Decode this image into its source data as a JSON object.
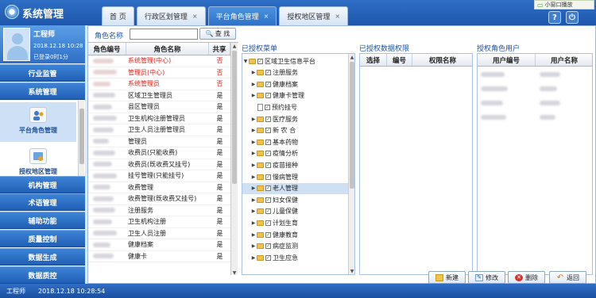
{
  "app": {
    "title": "系统管理"
  },
  "tabs": [
    {
      "label": "首 页",
      "closable": false
    },
    {
      "label": "行政区划管理",
      "closable": true
    },
    {
      "label": "平台角色管理",
      "closable": true,
      "active": true
    },
    {
      "label": "授权地区管理",
      "closable": true
    }
  ],
  "top": {
    "mini_player": "小窗口播放",
    "close_glyph": "×"
  },
  "user": {
    "name": "工程师",
    "date": "2018.12.18 10:28",
    "login_info": "已登录0时1分"
  },
  "sidebar": {
    "menus_top": [
      "行业监管",
      "系统管理"
    ],
    "sub_items": [
      "平台角色管理",
      "授权地区管理"
    ],
    "menus_bottom": [
      "机构管理",
      "术语管理",
      "辅助功能",
      "质量控制",
      "数据生成",
      "数据质控"
    ]
  },
  "filter": {
    "label": "角色名称",
    "value": "",
    "search_label": "查 找"
  },
  "role_grid": {
    "headers": [
      "角色编号",
      "角色名称",
      "共享"
    ],
    "rows": [
      {
        "name": "系统管理(中心)",
        "shared": "否",
        "highlight": true
      },
      {
        "name": "管理员(中心)",
        "shared": "否",
        "highlight": true
      },
      {
        "name": "系统管理员",
        "shared": "否",
        "highlight": true
      },
      {
        "name": "区域卫生管理员",
        "shared": "是"
      },
      {
        "name": "县区管理员",
        "shared": "是"
      },
      {
        "name": "卫生机构注册管理员",
        "shared": "是"
      },
      {
        "name": "卫生人员注册管理员",
        "shared": "是"
      },
      {
        "name": "管理员",
        "shared": "是"
      },
      {
        "name": "收费员(只能收费)",
        "shared": "是"
      },
      {
        "name": "收费员(既收费又挂号)",
        "shared": "是"
      },
      {
        "name": "挂号管理(只能挂号)",
        "shared": "是"
      },
      {
        "name": "收费管理",
        "shared": "是"
      },
      {
        "name": "收费管理(既收费又挂号)",
        "shared": "是"
      },
      {
        "name": "注册服务",
        "shared": "是"
      },
      {
        "name": "卫生机构注册",
        "shared": "是"
      },
      {
        "name": "卫生人员注册",
        "shared": "是"
      },
      {
        "name": "健康档案",
        "shared": "是"
      },
      {
        "name": "健康卡",
        "shared": "是"
      }
    ]
  },
  "menu_tree": {
    "title": "已授权菜单",
    "root": "区域卫生信息平台",
    "children": [
      {
        "label": "注册服务",
        "type": "folder"
      },
      {
        "label": "健康档案",
        "type": "folder"
      },
      {
        "label": "健康卡管理",
        "type": "folder"
      },
      {
        "label": "预约挂号",
        "type": "doc"
      },
      {
        "label": "医疗服务",
        "type": "folder"
      },
      {
        "label": "新 农 合",
        "type": "folder"
      },
      {
        "label": "基本药物",
        "type": "folder"
      },
      {
        "label": "疫情分析",
        "type": "folder"
      },
      {
        "label": "疫苗接种",
        "type": "folder"
      },
      {
        "label": "慢病管理",
        "type": "folder"
      },
      {
        "label": "老人管理",
        "type": "folder",
        "selected": true
      },
      {
        "label": "妇女保健",
        "type": "folder"
      },
      {
        "label": "儿童保健",
        "type": "folder"
      },
      {
        "label": "计划生育",
        "type": "folder"
      },
      {
        "label": "健康教育",
        "type": "folder"
      },
      {
        "label": "病症监测",
        "type": "folder"
      },
      {
        "label": "卫生应急",
        "type": "folder"
      }
    ]
  },
  "data_perm": {
    "title": "已授权数据权限",
    "headers": [
      "选择",
      "编号",
      "权限名称"
    ]
  },
  "perm_users": {
    "title": "授权角色用户",
    "headers": [
      "用户编号",
      "用户名称"
    ]
  },
  "actions": {
    "new_label": "新建",
    "edit_label": "修改",
    "delete_label": "删除",
    "back_label": "返回"
  },
  "status": {
    "user": "工程师",
    "datetime": "2018.12.18 10:28:54"
  },
  "colors": {
    "primary": "#2f6fc6",
    "highlight_text": "#e0241b"
  }
}
